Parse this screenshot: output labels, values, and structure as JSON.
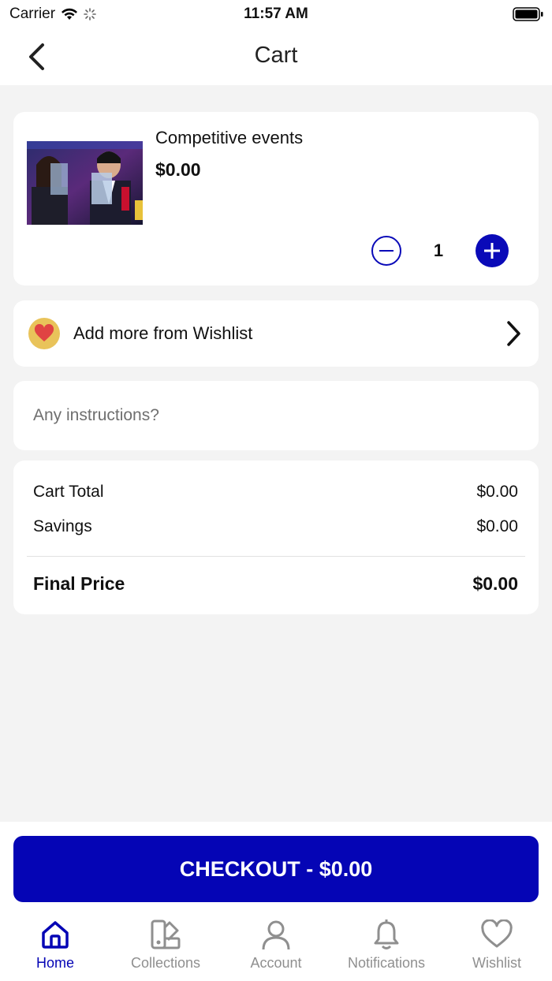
{
  "status_bar": {
    "carrier": "Carrier",
    "time": "11:57 AM"
  },
  "header": {
    "title": "Cart"
  },
  "cart_item": {
    "name": "Competitive events",
    "price": "$0.00",
    "quantity": "1",
    "thumbnail_icon": "event-photo"
  },
  "wishlist_row": {
    "label": "Add more from Wishlist"
  },
  "instructions": {
    "placeholder": "Any instructions?",
    "value": ""
  },
  "summary": {
    "cart_total_label": "Cart Total",
    "cart_total_value": "$0.00",
    "savings_label": "Savings",
    "savings_value": "$0.00",
    "final_label": "Final Price",
    "final_value": "$0.00"
  },
  "checkout": {
    "label": "CHECKOUT - $0.00"
  },
  "tabs": [
    {
      "label": "Home",
      "icon": "home-icon",
      "active": true
    },
    {
      "label": "Collections",
      "icon": "collections-icon",
      "active": false
    },
    {
      "label": "Account",
      "icon": "account-icon",
      "active": false
    },
    {
      "label": "Notifications",
      "icon": "bell-icon",
      "active": false
    },
    {
      "label": "Wishlist",
      "icon": "heart-icon",
      "active": false
    }
  ],
  "colors": {
    "accent": "#0505b5",
    "background": "#f3f3f3",
    "inactive_tab": "#8f8f8f"
  }
}
